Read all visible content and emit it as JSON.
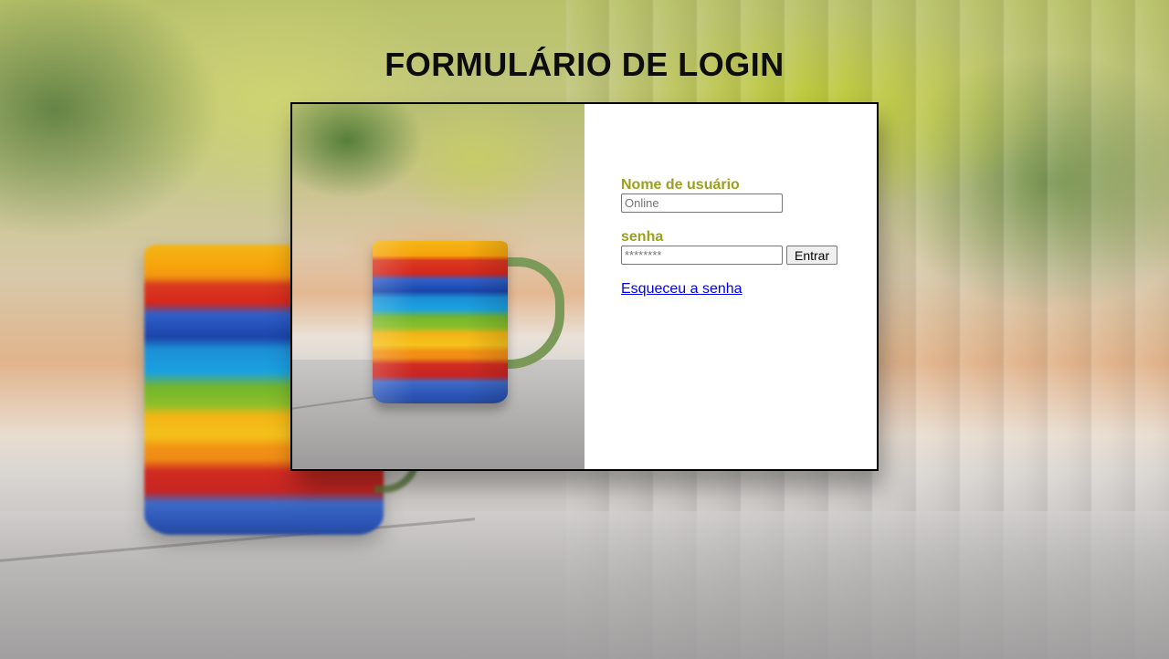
{
  "page": {
    "title": "FORMULÁRIO DE LOGIN"
  },
  "form": {
    "username_label": "Nome de usuário",
    "username_placeholder": "Online",
    "username_value": "",
    "password_label": "senha",
    "password_placeholder": "********",
    "password_value": "",
    "submit_label": "Entrar",
    "forgot_link": "Esqueceu a senha"
  },
  "colors": {
    "label_color": "#9aa01e",
    "link_color": "#0000ee",
    "title_color": "#0d0d0d"
  }
}
